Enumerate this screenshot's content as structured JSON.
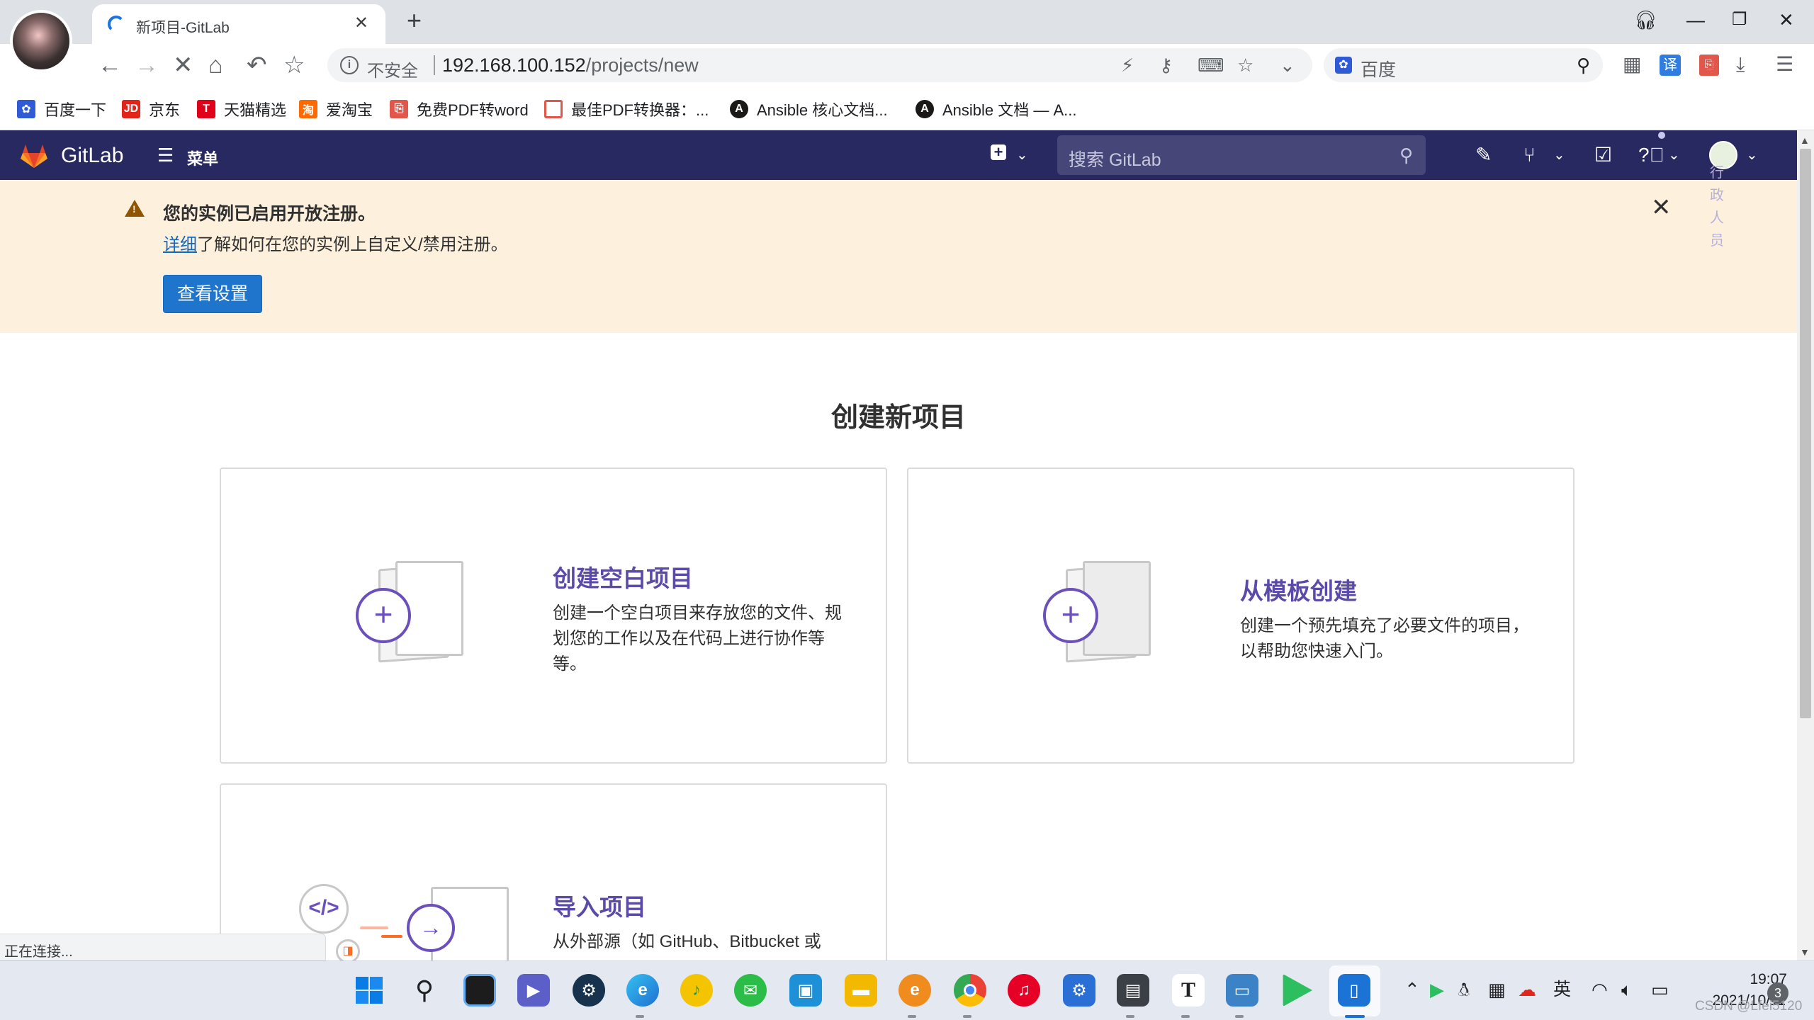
{
  "browser": {
    "tab_title": "新项目-GitLab",
    "omnibox": {
      "insecure_label": "不安全",
      "url_host": "192.168.100.152",
      "url_path": "/projects/new"
    },
    "search_engine_label": "百度",
    "bookmarks": [
      {
        "label": "百度一下",
        "icon": "baidu-icon",
        "color": "#2f5bd6"
      },
      {
        "label": "京东",
        "icon": "jd-icon",
        "color": "#e1251b"
      },
      {
        "label": "天猫精选",
        "icon": "tmall-icon",
        "color": "#e1001a"
      },
      {
        "label": "爱淘宝",
        "icon": "taobao-icon",
        "color": "#ff6a00"
      },
      {
        "label": "免费PDF转word",
        "icon": "pdf-icon",
        "color": "#e2574c"
      },
      {
        "label": "最佳PDF转换器：...",
        "icon": "pdf-converter-icon",
        "color": "#e2574c"
      },
      {
        "label": "Ansible 核心文档...",
        "icon": "ansible-icon",
        "color": "#1a1918"
      },
      {
        "label": "Ansible 文档 — A...",
        "icon": "ansible-icon",
        "color": "#1a1918"
      }
    ],
    "status_text": "正在连接..."
  },
  "gitlab": {
    "brand": "GitLab",
    "menu_label": "菜单",
    "search_placeholder": "搜索 GitLab",
    "user_text": "行政人员",
    "banner": {
      "title": "您的实例已启用开放注册。",
      "link_text": "详细",
      "text": "了解如何在您的实例上自定义/禁用注册。",
      "button_label": "查看设置"
    },
    "page_title": "创建新项目",
    "cards": [
      {
        "title": "创建空白项目",
        "description": "创建一个空白项目来存放您的文件、规划您的工作以及在代码上进行协作等等。"
      },
      {
        "title": "从模板创建",
        "description": "创建一个预先填充了必要文件的项目，以帮助您快速入门。"
      },
      {
        "title": "导入项目",
        "description": "从外部源（如 GitHub、Bitbucket 或"
      }
    ],
    "colors": {
      "header": "#292961",
      "accent": "#6b4fbb",
      "banner_bg": "#fdf1dd",
      "button": "#1f75cb"
    }
  },
  "taskbar": {
    "language": "英",
    "time": "19:07",
    "date": "2021/10/11",
    "notification_count": "3"
  },
  "watermark": "CSDN @Lfei5120"
}
